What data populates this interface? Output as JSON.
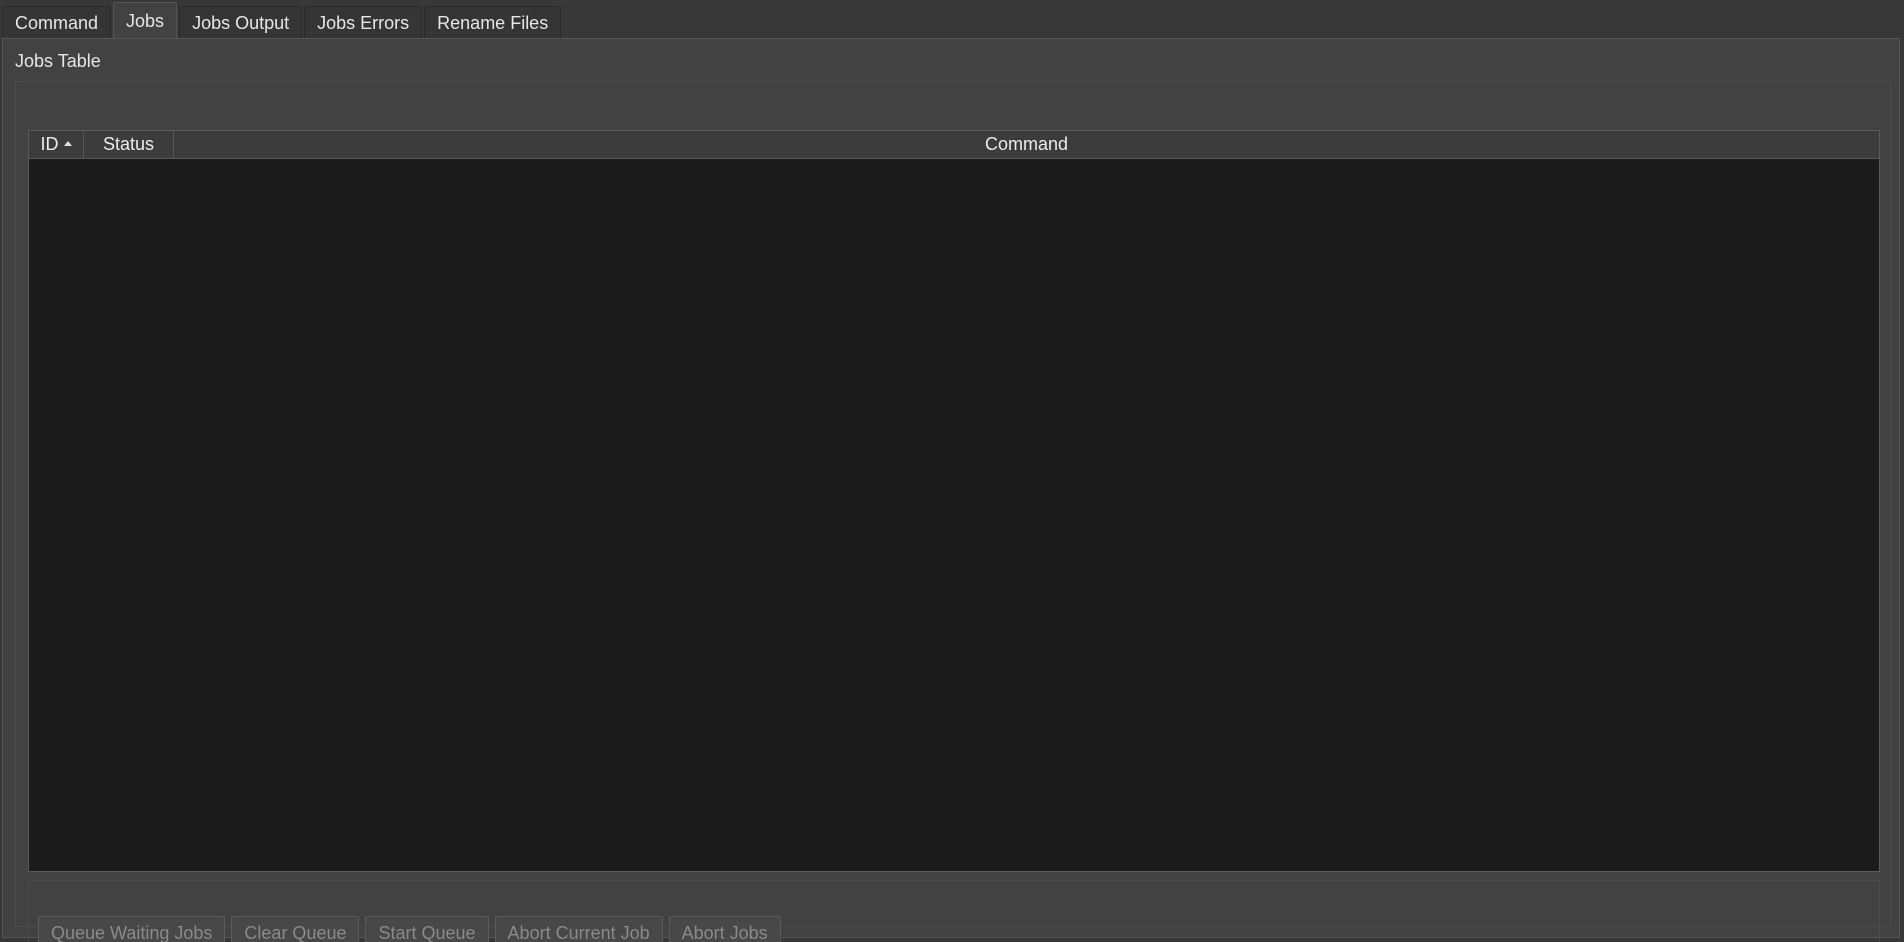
{
  "tabs": [
    {
      "label": "Command",
      "active": false
    },
    {
      "label": "Jobs",
      "active": true
    },
    {
      "label": "Jobs Output",
      "active": false
    },
    {
      "label": "Jobs Errors",
      "active": false
    },
    {
      "label": "Rename Files",
      "active": false
    }
  ],
  "jobs_table": {
    "title": "Jobs Table",
    "columns": [
      "ID",
      "Status",
      "Command"
    ],
    "sort_column": "ID",
    "sort_direction": "ascending",
    "rows": []
  },
  "buttons": {
    "queue_waiting": "Queue Waiting Jobs",
    "clear_queue": "Clear Queue",
    "start_queue": "Start Queue",
    "abort_current": "Abort Current Job",
    "abort_jobs": "Abort Jobs"
  },
  "colors": {
    "background": "#383838",
    "panel": "#424242",
    "table_body": "#1b1b1b",
    "disabled_text": "#8a8a8a"
  }
}
